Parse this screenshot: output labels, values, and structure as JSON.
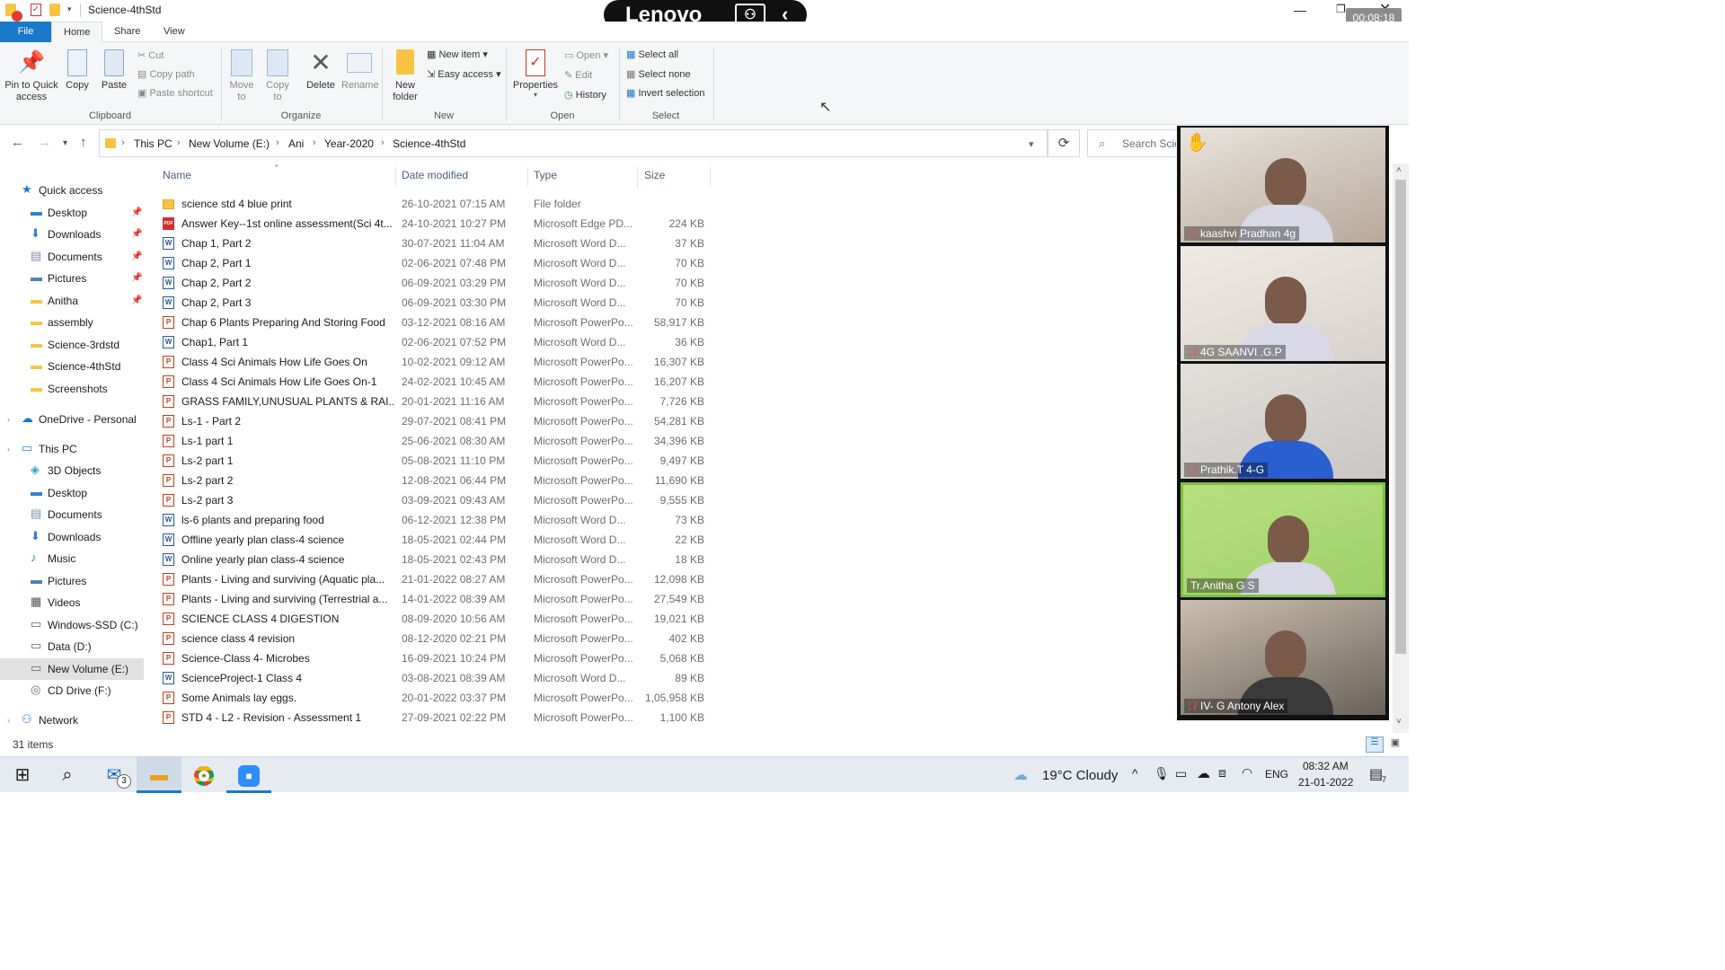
{
  "window": {
    "title": "Science-4thStd",
    "timer": "00:08:18"
  },
  "overlay": {
    "brand": "Lenovo"
  },
  "tabs": {
    "file": "File",
    "home": "Home",
    "share": "Share",
    "view": "View"
  },
  "ribbon": {
    "clipboard": {
      "pin": "Pin to Quick access",
      "copy": "Copy",
      "paste": "Paste",
      "cut": "Cut",
      "copy_path": "Copy path",
      "paste_shortcut": "Paste shortcut",
      "label": "Clipboard"
    },
    "organize": {
      "move_to": "Move to",
      "copy_to": "Copy to",
      "delete": "Delete",
      "rename": "Rename",
      "label": "Organize"
    },
    "new": {
      "new_folder": "New folder",
      "new_item": "New item",
      "easy_access": "Easy access",
      "label": "New"
    },
    "open": {
      "properties": "Properties",
      "open": "Open",
      "edit": "Edit",
      "history": "History",
      "label": "Open"
    },
    "select": {
      "select_all": "Select all",
      "select_none": "Select none",
      "invert": "Invert selection",
      "label": "Select"
    }
  },
  "address": {
    "crumbs": [
      "This PC",
      "New Volume (E:)",
      "Ani",
      "Year-2020",
      "Science-4thStd"
    ],
    "search_placeholder": "Search Science-4thStd"
  },
  "nav": [
    {
      "label": "Quick access",
      "type": "quick",
      "indent": 0,
      "pin": false
    },
    {
      "label": "Desktop",
      "type": "desktop",
      "indent": 1,
      "pin": true
    },
    {
      "label": "Downloads",
      "type": "download",
      "indent": 1,
      "pin": true
    },
    {
      "label": "Documents",
      "type": "doc",
      "indent": 1,
      "pin": true
    },
    {
      "label": "Pictures",
      "type": "pic",
      "indent": 1,
      "pin": true
    },
    {
      "label": "Anitha",
      "type": "folder",
      "indent": 1,
      "pin": true
    },
    {
      "label": "assembly",
      "type": "folder",
      "indent": 1,
      "pin": false
    },
    {
      "label": "Science-3rdstd",
      "type": "folder",
      "indent": 1,
      "pin": false
    },
    {
      "label": "Science-4thStd",
      "type": "folder",
      "indent": 1,
      "pin": false
    },
    {
      "label": "Screenshots",
      "type": "folder",
      "indent": 1,
      "pin": false
    },
    {
      "label": "OneDrive - Personal",
      "type": "cloud",
      "indent": 0,
      "pin": false
    },
    {
      "label": "This PC",
      "type": "pc",
      "indent": 0,
      "pin": false
    },
    {
      "label": "3D Objects",
      "type": "3d",
      "indent": 1,
      "pin": false
    },
    {
      "label": "Desktop",
      "type": "desktop",
      "indent": 1,
      "pin": false
    },
    {
      "label": "Documents",
      "type": "doc",
      "indent": 1,
      "pin": false
    },
    {
      "label": "Downloads",
      "type": "download",
      "indent": 1,
      "pin": false
    },
    {
      "label": "Music",
      "type": "music",
      "indent": 1,
      "pin": false
    },
    {
      "label": "Pictures",
      "type": "pic",
      "indent": 1,
      "pin": false
    },
    {
      "label": "Videos",
      "type": "video",
      "indent": 1,
      "pin": false
    },
    {
      "label": "Windows-SSD (C:)",
      "type": "drive",
      "indent": 1,
      "pin": false
    },
    {
      "label": "Data (D:)",
      "type": "drive",
      "indent": 1,
      "pin": false
    },
    {
      "label": "New Volume (E:)",
      "type": "drive",
      "indent": 1,
      "pin": false,
      "selected": true
    },
    {
      "label": "CD Drive (F:)",
      "type": "cd",
      "indent": 1,
      "pin": false
    },
    {
      "label": "Network",
      "type": "net",
      "indent": 0,
      "pin": false
    }
  ],
  "columns": {
    "name": "Name",
    "date": "Date modified",
    "type": "Type",
    "size": "Size"
  },
  "files": [
    {
      "name": "science std 4 blue print",
      "date": "26-10-2021 07:15 AM",
      "type": "File folder",
      "size": "",
      "kind": "folder"
    },
    {
      "name": "Answer Key--1st online assessment(Sci 4t...",
      "date": "24-10-2021 10:27 PM",
      "type": "Microsoft Edge PD...",
      "size": "224 KB",
      "kind": "pdf"
    },
    {
      "name": "Chap 1, Part 2",
      "date": "30-07-2021 11:04 AM",
      "type": "Microsoft Word D...",
      "size": "37 KB",
      "kind": "word"
    },
    {
      "name": "Chap 2, Part 1",
      "date": "02-06-2021 07:48 PM",
      "type": "Microsoft Word D...",
      "size": "70 KB",
      "kind": "word"
    },
    {
      "name": "Chap 2, Part 2",
      "date": "06-09-2021 03:29 PM",
      "type": "Microsoft Word D...",
      "size": "70 KB",
      "kind": "word"
    },
    {
      "name": "Chap 2, Part 3",
      "date": "06-09-2021 03:30 PM",
      "type": "Microsoft Word D...",
      "size": "70 KB",
      "kind": "word"
    },
    {
      "name": "Chap 6 Plants Preparing And Storing Food",
      "date": "03-12-2021 08:16 AM",
      "type": "Microsoft PowerPo...",
      "size": "58,917 KB",
      "kind": "ppt"
    },
    {
      "name": "Chap1, Part 1",
      "date": "02-06-2021 07:52 PM",
      "type": "Microsoft Word D...",
      "size": "36 KB",
      "kind": "word"
    },
    {
      "name": "Class 4 Sci Animals How Life Goes On",
      "date": "10-02-2021 09:12 AM",
      "type": "Microsoft PowerPo...",
      "size": "16,307 KB",
      "kind": "ppt"
    },
    {
      "name": "Class 4 Sci Animals How Life Goes On-1",
      "date": "24-02-2021 10:45 AM",
      "type": "Microsoft PowerPo...",
      "size": "16,207 KB",
      "kind": "ppt"
    },
    {
      "name": "GRASS FAMILY,UNUSUAL PLANTS & RAI...",
      "date": "20-01-2021 11:16 AM",
      "type": "Microsoft PowerPo...",
      "size": "7,726 KB",
      "kind": "ppt"
    },
    {
      "name": "Ls-1 - Part 2",
      "date": "29-07-2021 08:41 PM",
      "type": "Microsoft PowerPo...",
      "size": "54,281 KB",
      "kind": "ppt"
    },
    {
      "name": "Ls-1 part 1",
      "date": "25-06-2021 08:30 AM",
      "type": "Microsoft PowerPo...",
      "size": "34,396 KB",
      "kind": "ppt"
    },
    {
      "name": "Ls-2 part 1",
      "date": "05-08-2021 11:10 PM",
      "type": "Microsoft PowerPo...",
      "size": "9,497 KB",
      "kind": "ppt"
    },
    {
      "name": "Ls-2 part 2",
      "date": "12-08-2021 06:44 PM",
      "type": "Microsoft PowerPo...",
      "size": "11,690 KB",
      "kind": "ppt"
    },
    {
      "name": "Ls-2 part 3",
      "date": "03-09-2021 09:43 AM",
      "type": "Microsoft PowerPo...",
      "size": "9,555 KB",
      "kind": "ppt"
    },
    {
      "name": "ls-6 plants and preparing food",
      "date": "06-12-2021 12:38 PM",
      "type": "Microsoft Word D...",
      "size": "73 KB",
      "kind": "word"
    },
    {
      "name": "Offline yearly plan class-4 science",
      "date": "18-05-2021 02:44 PM",
      "type": "Microsoft Word D...",
      "size": "22 KB",
      "kind": "word"
    },
    {
      "name": "Online yearly plan class-4 science",
      "date": "18-05-2021 02:43 PM",
      "type": "Microsoft Word D...",
      "size": "18 KB",
      "kind": "word"
    },
    {
      "name": "Plants - Living and surviving (Aquatic pla...",
      "date": "21-01-2022 08:27 AM",
      "type": "Microsoft PowerPo...",
      "size": "12,098 KB",
      "kind": "ppt"
    },
    {
      "name": "Plants - Living and surviving (Terrestrial a...",
      "date": "14-01-2022 08:39 AM",
      "type": "Microsoft PowerPo...",
      "size": "27,549 KB",
      "kind": "ppt"
    },
    {
      "name": "SCIENCE CLASS 4 DIGESTION",
      "date": "08-09-2020 10:56 AM",
      "type": "Microsoft PowerPo...",
      "size": "19,021 KB",
      "kind": "ppt"
    },
    {
      "name": "science class 4 revision",
      "date": "08-12-2020 02:21 PM",
      "type": "Microsoft PowerPo...",
      "size": "402 KB",
      "kind": "ppt"
    },
    {
      "name": "Science-Class 4- Microbes",
      "date": "16-09-2021 10:24 PM",
      "type": "Microsoft PowerPo...",
      "size": "5,068 KB",
      "kind": "ppt"
    },
    {
      "name": "ScienceProject-1 Class 4",
      "date": "03-08-2021 08:39 AM",
      "type": "Microsoft Word D...",
      "size": "89 KB",
      "kind": "word"
    },
    {
      "name": "Some Animals lay eggs.",
      "date": "20-01-2022 03:37 PM",
      "type": "Microsoft PowerPo...",
      "size": "1,05,958 KB",
      "kind": "ppt"
    },
    {
      "name": "STD 4 - L2 - Revision - Assessment 1",
      "date": "27-09-2021 02:22 PM",
      "type": "Microsoft PowerPo...",
      "size": "1,100 KB",
      "kind": "ppt"
    }
  ],
  "status": {
    "items": "31 items"
  },
  "participants": [
    {
      "name": "kaashvi Pradhan 4g",
      "bg1": "#b8a89a",
      "bg2": "#e8e4dc",
      "hand": true
    },
    {
      "name": "4G SAANVI .G.P",
      "bg1": "#d9d2cc",
      "bg2": "#efeae4",
      "hand": false
    },
    {
      "name": "Prathik.T 4-G",
      "bg1": "#c9c6c4",
      "bg2": "#e2dfdb",
      "hand": false
    },
    {
      "name": "Tr.Anitha G S",
      "bg1": "#9fd06a",
      "bg2": "#b7e07f",
      "hand": false
    },
    {
      "name": "IV- G Antony Alex",
      "bg1": "#6a625a",
      "bg2": "#cbbfae",
      "hand": false
    }
  ],
  "taskbar": {
    "weather": "19°C  Cloudy",
    "lang": "ENG",
    "time": "08:32 AM",
    "date": "21-01-2022",
    "mail_badge": "3",
    "notif_badge": "7"
  },
  "colors": {
    "accent": "#1979ca",
    "word": "#2b579a",
    "ppt": "#c43e1c",
    "pdf": "#d0312d",
    "folder": "#f8c342",
    "selected_tile": "#7dc242"
  }
}
